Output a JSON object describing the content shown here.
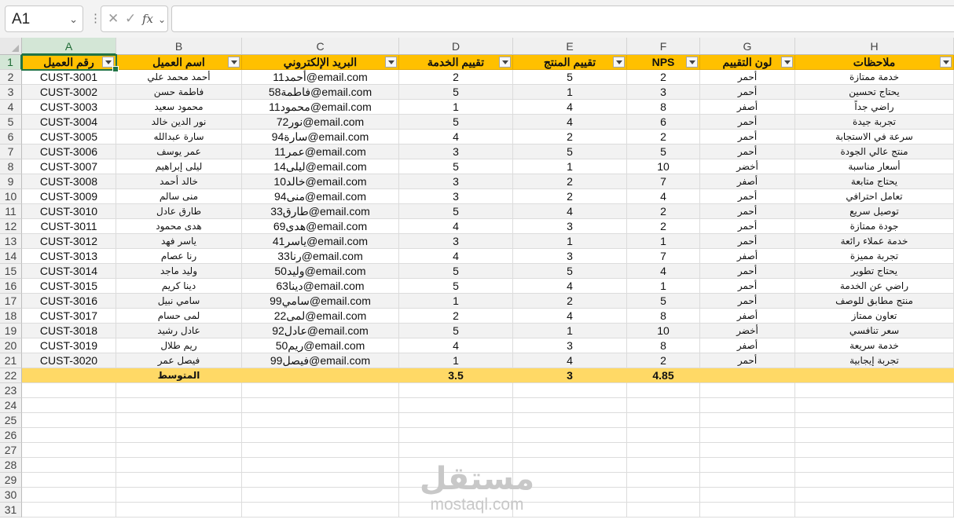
{
  "name_box": {
    "value": "A1"
  },
  "formula_bar": {
    "cancel_glyph": "✕",
    "enter_glyph": "✓",
    "fx_label": "fx",
    "value": ""
  },
  "columns": [
    "A",
    "B",
    "C",
    "D",
    "E",
    "F",
    "G",
    "H"
  ],
  "row_numbers": [
    "1",
    "2",
    "3",
    "4",
    "5",
    "6",
    "7",
    "8",
    "9",
    "10",
    "11",
    "12",
    "13",
    "14",
    "15",
    "16",
    "17",
    "18",
    "19",
    "20",
    "21",
    "22",
    "23",
    "24",
    "25",
    "26",
    "27",
    "28",
    "29",
    "30",
    "31"
  ],
  "headers": [
    "رقم العميل",
    "اسم العميل",
    "البريد الإلكتروني",
    "تقييم الخدمة",
    "تقييم المنتج",
    "NPS",
    "لون التقييم",
    "ملاحظات"
  ],
  "rows": [
    [
      "CUST-3001",
      "أحمد محمد علي",
      "أحمد11@email.com",
      "2",
      "5",
      "2",
      "أحمر",
      "خدمة ممتازة"
    ],
    [
      "CUST-3002",
      "فاطمة حسن",
      "فاطمة58@email.com",
      "5",
      "1",
      "3",
      "أحمر",
      "يحتاج تحسين"
    ],
    [
      "CUST-3003",
      "محمود سعيد",
      "محمود11@email.com",
      "1",
      "4",
      "8",
      "أصفر",
      "راضي جداً"
    ],
    [
      "CUST-3004",
      "نور الدين خالد",
      "نور72@email.com",
      "5",
      "4",
      "6",
      "أحمر",
      "تجربة جيدة"
    ],
    [
      "CUST-3005",
      "سارة عبدالله",
      "سارة94@email.com",
      "4",
      "2",
      "2",
      "أحمر",
      "سرعة في الاستجابة"
    ],
    [
      "CUST-3006",
      "عمر يوسف",
      "عمر11@email.com",
      "3",
      "5",
      "5",
      "أحمر",
      "منتج عالي الجودة"
    ],
    [
      "CUST-3007",
      "ليلى إبراهيم",
      "ليلى14@email.com",
      "5",
      "1",
      "10",
      "أخضر",
      "أسعار مناسبة"
    ],
    [
      "CUST-3008",
      "خالد أحمد",
      "خالد10@email.com",
      "3",
      "2",
      "7",
      "أصفر",
      "يحتاج متابعة"
    ],
    [
      "CUST-3009",
      "منى سالم",
      "منى94@email.com",
      "3",
      "2",
      "4",
      "أحمر",
      "تعامل احترافي"
    ],
    [
      "CUST-3010",
      "طارق عادل",
      "طارق33@email.com",
      "5",
      "4",
      "2",
      "أحمر",
      "توصيل سريع"
    ],
    [
      "CUST-3011",
      "هدى محمود",
      "هدى69@email.com",
      "4",
      "3",
      "2",
      "أحمر",
      "جودة ممتازة"
    ],
    [
      "CUST-3012",
      "ياسر فهد",
      "ياسر41@email.com",
      "3",
      "1",
      "1",
      "أحمر",
      "خدمة عملاء رائعة"
    ],
    [
      "CUST-3013",
      "رنا عصام",
      "رنا33@email.com",
      "4",
      "3",
      "7",
      "أصفر",
      "تجربة مميزة"
    ],
    [
      "CUST-3014",
      "وليد ماجد",
      "وليد50@email.com",
      "5",
      "5",
      "4",
      "أحمر",
      "يحتاج تطوير"
    ],
    [
      "CUST-3015",
      "دينا كريم",
      "دينا63@email.com",
      "5",
      "4",
      "1",
      "أحمر",
      "راضي عن الخدمة"
    ],
    [
      "CUST-3016",
      "سامي نبيل",
      "سامي99@email.com",
      "1",
      "2",
      "5",
      "أحمر",
      "منتج مطابق للوصف"
    ],
    [
      "CUST-3017",
      "لمى حسام",
      "لمى22@email.com",
      "2",
      "4",
      "8",
      "أصفر",
      "تعاون ممتاز"
    ],
    [
      "CUST-3018",
      "عادل رشيد",
      "عادل92@email.com",
      "5",
      "1",
      "10",
      "أخضر",
      "سعر تنافسي"
    ],
    [
      "CUST-3019",
      "ريم طلال",
      "ريم50@email.com",
      "4",
      "3",
      "8",
      "أصفر",
      "خدمة سريعة"
    ],
    [
      "CUST-3020",
      "فيصل عمر",
      "فيصل99@email.com",
      "1",
      "4",
      "2",
      "أحمر",
      "تجربة إيجابية"
    ]
  ],
  "average_row": {
    "label": "المتوسط",
    "service": "3.5",
    "product": "3",
    "nps": "4.85"
  },
  "watermark": {
    "main": "مستقل",
    "sub": "mostaql.com"
  },
  "colors": {
    "header_fill": "#ffc000",
    "average_fill": "#ffd966",
    "band_fill": "#f2f2f2",
    "accent": "#217346"
  }
}
